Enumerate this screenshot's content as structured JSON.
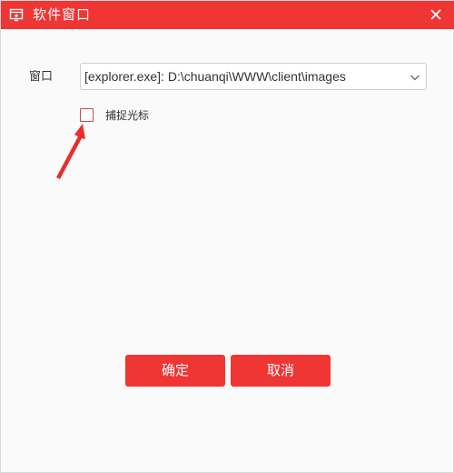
{
  "window": {
    "title": "软件窗口",
    "title_icon": "window-icon",
    "close_icon": "close-icon"
  },
  "form": {
    "window_label": "窗口",
    "window_select_value": "[explorer.exe]: D:\\chuanqi\\WWW\\client\\images",
    "capture_cursor_label": "捕捉光标",
    "capture_cursor_checked": false
  },
  "buttons": {
    "ok_label": "确定",
    "cancel_label": "取消"
  },
  "colors": {
    "accent": "#f03535",
    "annotation_arrow": "#ee2b2b"
  }
}
